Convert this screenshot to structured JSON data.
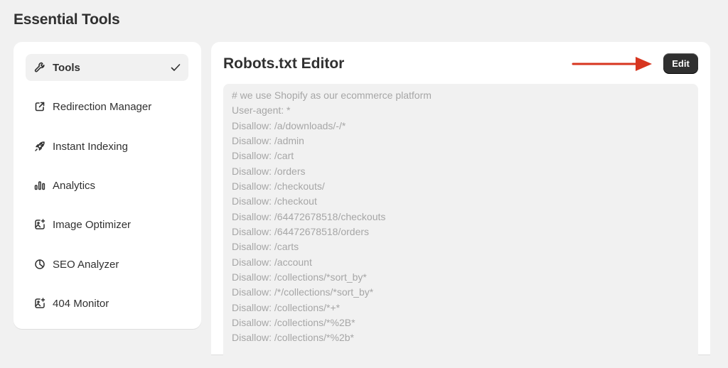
{
  "page": {
    "title": "Essential Tools"
  },
  "sidebar": {
    "items": [
      {
        "label": "Tools",
        "icon": "wrench-icon",
        "active": true
      },
      {
        "label": "Redirection Manager",
        "icon": "external-link-icon"
      },
      {
        "label": "Instant Indexing",
        "icon": "rocket-icon"
      },
      {
        "label": "Analytics",
        "icon": "bar-chart-icon"
      },
      {
        "label": "Image Optimizer",
        "icon": "image-sparkle-icon"
      },
      {
        "label": "SEO Analyzer",
        "icon": "target-icon"
      },
      {
        "label": "404 Monitor",
        "icon": "image-sparkle-icon"
      }
    ]
  },
  "editor": {
    "title": "Robots.txt Editor",
    "edit_label": "Edit",
    "lines": [
      "# we use Shopify as our ecommerce platform",
      "User-agent: *",
      "Disallow: /a/downloads/-/*",
      "Disallow: /admin",
      "Disallow: /cart",
      "Disallow: /orders",
      "Disallow: /checkouts/",
      "Disallow: /checkout",
      "Disallow: /64472678518/checkouts",
      "Disallow: /64472678518/orders",
      "Disallow: /carts",
      "Disallow: /account",
      "Disallow: /collections/*sort_by*",
      "Disallow: /*/collections/*sort_by*",
      "Disallow: /collections/*+*",
      "Disallow: /collections/*%2B*",
      "Disallow: /collections/*%2b*"
    ]
  },
  "colors": {
    "annotation_arrow": "#d7351f",
    "button_bg": "#303030"
  }
}
